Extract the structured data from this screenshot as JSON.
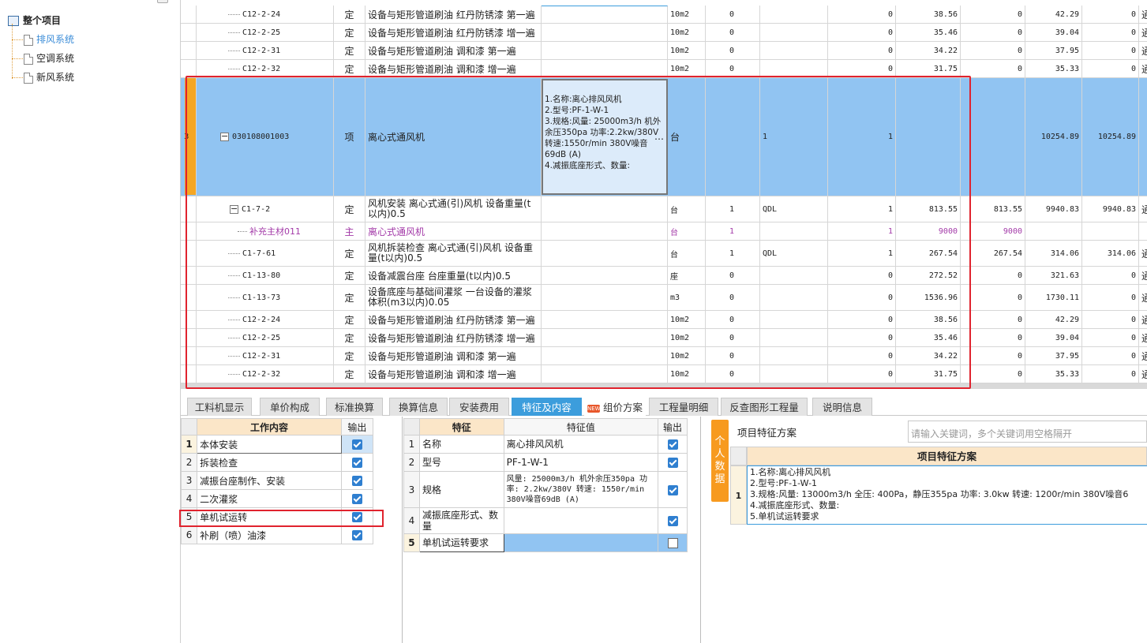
{
  "tree": {
    "root": "整个项目",
    "children": [
      "排风系统",
      "空调系统",
      "新风系统"
    ]
  },
  "grid_rows": [
    {
      "code": "C12-2-24",
      "cat": "定",
      "name": "设备与矩形管道刷油 红丹防锈漆 第一遍",
      "unit": "10m2",
      "qty": "0",
      "qdl": "",
      "q2": "0",
      "p1": "38.56",
      "p2": "0",
      "p3": "42.29",
      "p4": "0",
      "p5": "通"
    },
    {
      "code": "C12-2-25",
      "cat": "定",
      "name": "设备与矩形管道刷油 红丹防锈漆 增一遍",
      "unit": "10m2",
      "qty": "0",
      "qdl": "",
      "q2": "0",
      "p1": "35.46",
      "p2": "0",
      "p3": "39.04",
      "p4": "0",
      "p5": "通"
    },
    {
      "code": "C12-2-31",
      "cat": "定",
      "name": "设备与矩形管道刷油 调和漆 第一遍",
      "unit": "10m2",
      "qty": "0",
      "qdl": "",
      "q2": "0",
      "p1": "34.22",
      "p2": "0",
      "p3": "37.95",
      "p4": "0",
      "p5": "通"
    },
    {
      "code": "C12-2-32",
      "cat": "定",
      "name": "设备与矩形管道刷油 调和漆 增一遍",
      "unit": "10m2",
      "qty": "0",
      "qdl": "",
      "q2": "0",
      "p1": "31.75",
      "p2": "0",
      "p3": "35.33",
      "p4": "0",
      "p5": "通"
    }
  ],
  "selected_row": {
    "rownum": "3",
    "code": "030108001003",
    "cat": "项",
    "name": "离心式通风机",
    "feature": "1.名称:离心排风风机\n2.型号:PF-1-W-1\n3.规格:风量: 25000m3/h 机外余压350pa 功率:2.2kw/380V 转速:1550r/min 380V噪音69dB (A)\n4.减振底座形式、数量:",
    "ellipsis": "…",
    "unit": "台",
    "qty": "1",
    "q2": "1",
    "p3": "10254.89",
    "p4": "10254.89"
  },
  "grid_rows2": [
    {
      "code": "C1-7-2",
      "cat": "定",
      "name": "风机安装 离心式通(引)风机 设备重量(t以内)0.5",
      "unit": "台",
      "qty": "1",
      "qdl": "QDL",
      "q2": "1",
      "p1": "813.55",
      "p2": "813.55",
      "p3": "9940.83",
      "p4": "9940.83",
      "p5": "通",
      "exp": true,
      "h": 33
    },
    {
      "code": "补充主材011",
      "cat": "主",
      "name": "离心式通风机",
      "unit": "台",
      "qty": "1",
      "qdl": "",
      "q2": "1",
      "p1": "9000",
      "p2": "9000",
      "p3": "",
      "p4": "",
      "p5": "",
      "mat": true,
      "h": 23
    },
    {
      "code": "C1-7-61",
      "cat": "定",
      "name": "风机拆装检查 离心式通(引)风机 设备重量(t以内)0.5",
      "unit": "台",
      "qty": "1",
      "qdl": "QDL",
      "q2": "1",
      "p1": "267.54",
      "p2": "267.54",
      "p3": "314.06",
      "p4": "314.06",
      "p5": "通",
      "h": 33
    },
    {
      "code": "C1-13-80",
      "cat": "定",
      "name": "设备减震台座 台座重量(t以内)0.5",
      "unit": "座",
      "qty": "0",
      "qdl": "",
      "q2": "0",
      "p1": "272.52",
      "p2": "0",
      "p3": "321.63",
      "p4": "0",
      "p5": "通",
      "h": 23
    },
    {
      "code": "C1-13-73",
      "cat": "定",
      "name": "设备底座与基础间灌浆 一台设备的灌浆体积(m3以内)0.05",
      "unit": "m3",
      "qty": "0",
      "qdl": "",
      "q2": "0",
      "p1": "1536.96",
      "p2": "0",
      "p3": "1730.11",
      "p4": "0",
      "p5": "通",
      "h": 33
    },
    {
      "code": "C12-2-24",
      "cat": "定",
      "name": "设备与矩形管道刷油 红丹防锈漆 第一遍",
      "unit": "10m2",
      "qty": "0",
      "qdl": "",
      "q2": "0",
      "p1": "38.56",
      "p2": "0",
      "p3": "42.29",
      "p4": "0",
      "p5": "通",
      "h": 23
    },
    {
      "code": "C12-2-25",
      "cat": "定",
      "name": "设备与矩形管道刷油 红丹防锈漆 增一遍",
      "unit": "10m2",
      "qty": "0",
      "qdl": "",
      "q2": "0",
      "p1": "35.46",
      "p2": "0",
      "p3": "39.04",
      "p4": "0",
      "p5": "通",
      "h": 23
    },
    {
      "code": "C12-2-31",
      "cat": "定",
      "name": "设备与矩形管道刷油 调和漆 第一遍",
      "unit": "10m2",
      "qty": "0",
      "qdl": "",
      "q2": "0",
      "p1": "34.22",
      "p2": "0",
      "p3": "37.95",
      "p4": "0",
      "p5": "通",
      "h": 23
    },
    {
      "code": "C12-2-32",
      "cat": "定",
      "name": "设备与矩形管道刷油 调和漆 增一遍",
      "unit": "10m2",
      "qty": "0",
      "qdl": "",
      "q2": "0",
      "p1": "31.75",
      "p2": "0",
      "p3": "35.33",
      "p4": "0",
      "p5": "通",
      "h": 23
    }
  ],
  "tabs": [
    "工料机显示",
    "单价构成",
    "标准换算",
    "换算信息",
    "安装费用",
    "特征及内容",
    "组价方案",
    "工程量明细",
    "反查图形工程量",
    "说明信息"
  ],
  "active_tab": "特征及内容",
  "new_badge": "NEW",
  "work_content": {
    "headers": [
      "工作内容",
      "输出"
    ],
    "rows": [
      {
        "n": "1",
        "label": "本体安装",
        "checked": true
      },
      {
        "n": "2",
        "label": "拆装检查",
        "checked": true
      },
      {
        "n": "3",
        "label": "减振台座制作、安装",
        "checked": true
      },
      {
        "n": "4",
        "label": "二次灌浆",
        "checked": true
      },
      {
        "n": "5",
        "label": "单机试运转",
        "checked": true
      },
      {
        "n": "6",
        "label": "补刷（喷）油漆",
        "checked": true
      }
    ]
  },
  "features": {
    "headers": [
      "特征",
      "特征值",
      "输出"
    ],
    "rows": [
      {
        "n": "1",
        "label": "名称",
        "value": "离心排风风机",
        "checked": true
      },
      {
        "n": "2",
        "label": "型号",
        "value": "PF-1-W-1",
        "checked": true
      },
      {
        "n": "3",
        "label": "规格",
        "value": "风量: 25000m3/h 机外余压350pa 功率: 2.2kw/380V 转速: 1550r/min 380V噪音69dB (A)",
        "checked": true
      },
      {
        "n": "4",
        "label": "减振底座形式、数量",
        "value": "",
        "checked": true
      },
      {
        "n": "5",
        "label": "单机试运转要求",
        "value": "",
        "checked": false
      }
    ]
  },
  "personal_data": "个人数据",
  "scheme": {
    "label": "项目特征方案",
    "search_placeholder": "请输入关键词，多个关键词用空格隔开",
    "header": "项目特征方案",
    "rownum": "1",
    "lines": [
      "1.名称:离心排风风机",
      "2.型号:PF-1-W-1",
      "3.规格:风量: 13000m3/h  全压: 400Pa，静压355pa 功率: 3.0kw 转速: 1200r/min 380V噪音6",
      "4.减振底座形式、数量:",
      "5.单机试运转要求"
    ]
  }
}
